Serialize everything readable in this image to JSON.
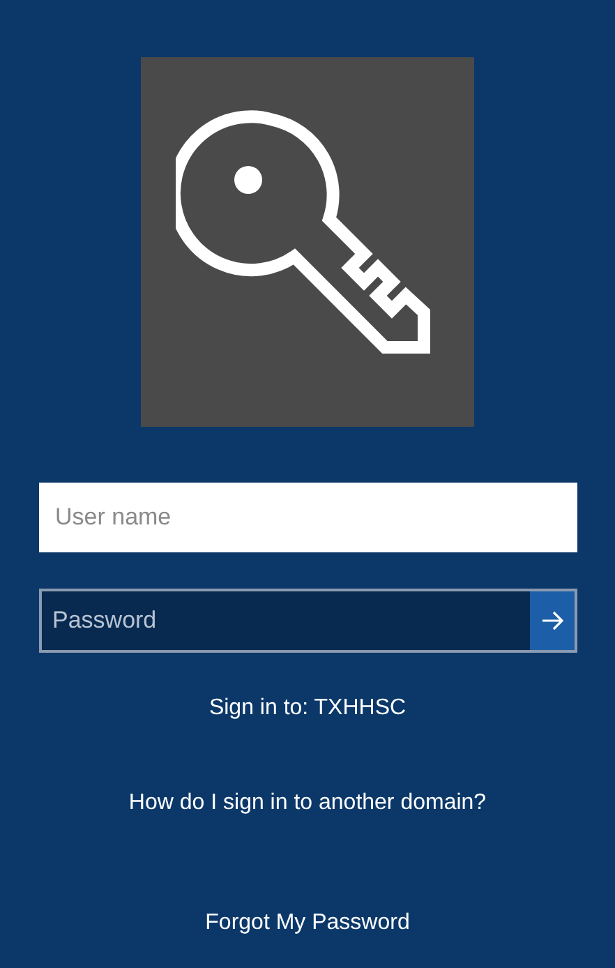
{
  "username": {
    "placeholder": "User name"
  },
  "password": {
    "placeholder": "Password"
  },
  "sign_in_to": "Sign in to: TXHHSC",
  "links": [
    "How do I sign in to another domain?",
    "Forgot My Password"
  ]
}
